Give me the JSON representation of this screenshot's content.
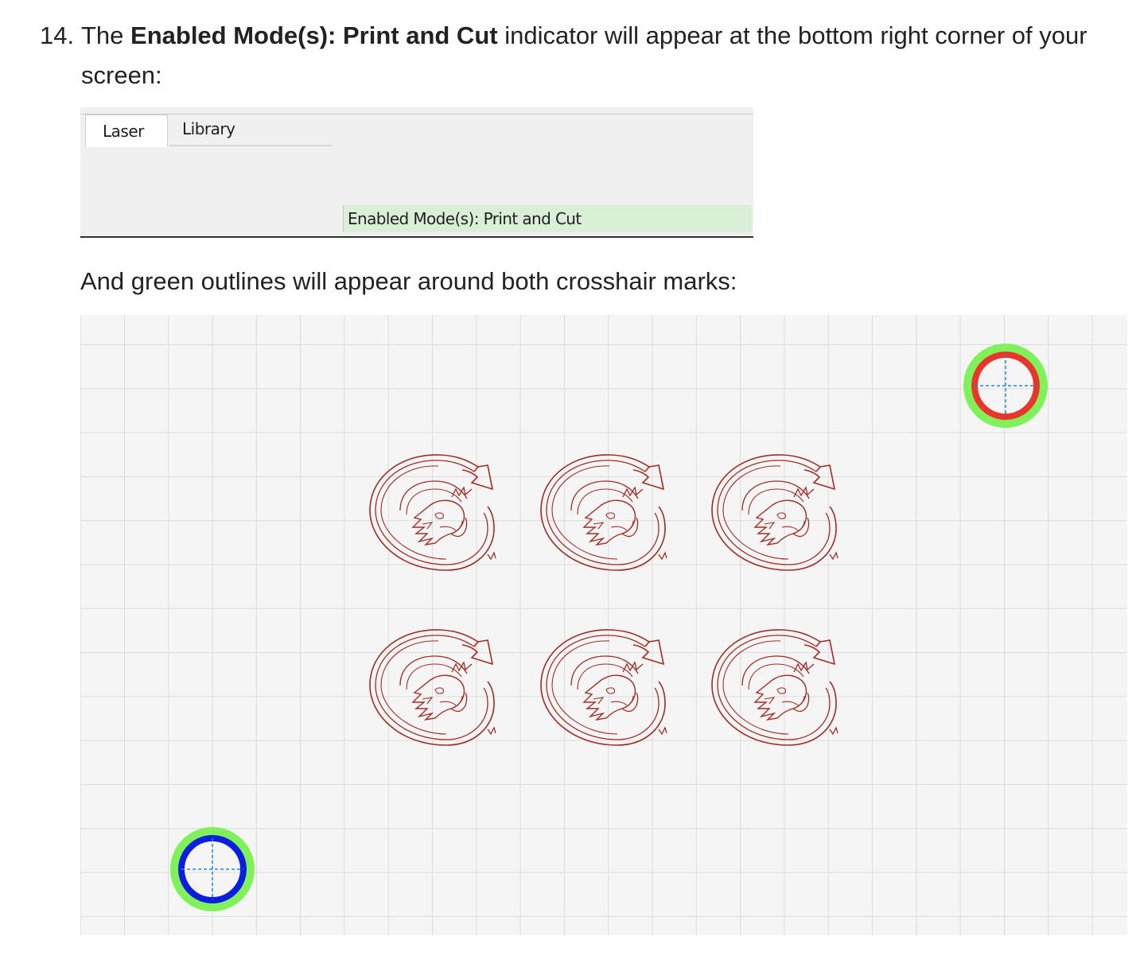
{
  "step": {
    "number": "14.",
    "text_before": "The ",
    "bold_text": "Enabled Mode(s): Print and Cut",
    "text_after": " indicator will appear at the bottom right corner of your",
    "text_continued": "screen:"
  },
  "panel_screenshot": {
    "tabs": [
      {
        "label": "Laser"
      },
      {
        "label": "Library"
      }
    ],
    "status_text": "Enabled Mode(s): Print and Cut"
  },
  "caption": "And green outlines will appear around both crosshair marks:",
  "canvas_screenshot": {
    "registration_marks": [
      {
        "name": "top-right",
        "ring_color": "#e8372a",
        "outline_color": "#7ff25a"
      },
      {
        "name": "bottom-left",
        "ring_color": "#0a1ee0",
        "outline_color": "#7ff25a"
      }
    ],
    "design_count": 6,
    "design_stroke_color": "#a42a22",
    "crosshair_color": "#1c8ad6"
  }
}
